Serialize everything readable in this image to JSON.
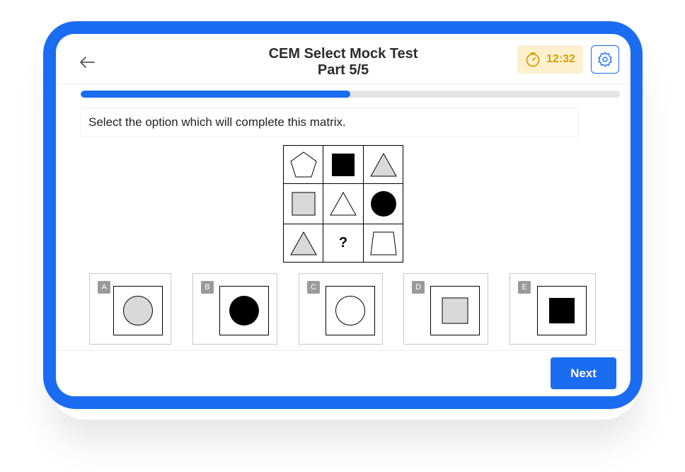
{
  "header": {
    "title_line1": "CEM Select Mock Test",
    "title_line2": "Part 5/5",
    "timer": "12:32",
    "back_icon": "arrow-left-icon",
    "timer_icon": "stopwatch-icon",
    "settings_icon": "gear-icon"
  },
  "progress": {
    "fraction": 0.5
  },
  "question": {
    "text": "Select the option which will complete this matrix."
  },
  "matrix": {
    "cells": [
      "white pentagon",
      "black square",
      "grey triangle",
      "grey square",
      "white triangle",
      "black circle",
      "grey triangle",
      "?",
      "white trapezium"
    ],
    "missing_mark": "?"
  },
  "options": [
    {
      "letter": "A",
      "shape": "grey circle in square"
    },
    {
      "letter": "B",
      "shape": "black circle in square"
    },
    {
      "letter": "C",
      "shape": "white circle in square"
    },
    {
      "letter": "D",
      "shape": "grey square in square"
    },
    {
      "letter": "E",
      "shape": "black square in square"
    }
  ],
  "footer": {
    "next_label": "Next"
  },
  "colors": {
    "accent": "#1a6cf0",
    "timer_bg": "#fdf0cf",
    "timer_text": "#d4a008",
    "shape_grey": "#d9d9d9"
  }
}
